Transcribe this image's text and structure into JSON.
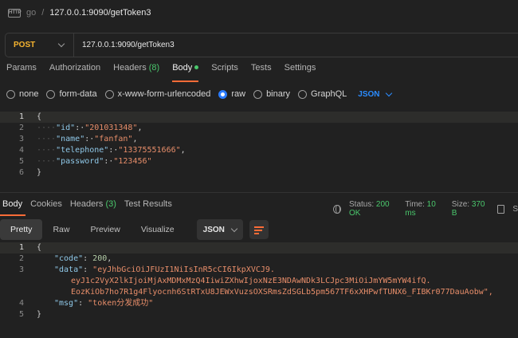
{
  "breadcrumb": {
    "badge": "HTTP",
    "workspace": "go",
    "separator": "/",
    "request_name": "127.0.0.1:9090/getToken3"
  },
  "url_bar": {
    "method": "POST",
    "url": "127.0.0.1:9090/getToken3",
    "method_color": "#f6b42f"
  },
  "request_tabs": [
    {
      "label": "Params"
    },
    {
      "label": "Authorization"
    },
    {
      "label": "Headers",
      "count": "(8)"
    },
    {
      "label": "Body",
      "active": true
    },
    {
      "label": "Scripts"
    },
    {
      "label": "Tests"
    },
    {
      "label": "Settings"
    }
  ],
  "body_types": {
    "options": [
      "none",
      "form-data",
      "x-www-form-urlencoded",
      "raw",
      "binary",
      "GraphQL"
    ],
    "selected": "raw",
    "format": "JSON"
  },
  "request_body": {
    "lines": [
      {
        "n": "1",
        "text": "{"
      },
      {
        "n": "2",
        "key": "\"id\"",
        "value": "\"201031348\""
      },
      {
        "n": "3",
        "key": "\"name\"",
        "value": "\"fanfan\""
      },
      {
        "n": "4",
        "key": "\"telephone\"",
        "value": "\"13375551666\""
      },
      {
        "n": "5",
        "key": "\"password\"",
        "value": "\"123456\""
      },
      {
        "n": "6",
        "text": "}"
      }
    ]
  },
  "response_tabs": [
    {
      "label": "Body",
      "active": true
    },
    {
      "label": "Cookies"
    },
    {
      "label": "Headers",
      "count": "(3)"
    },
    {
      "label": "Test Results"
    }
  ],
  "response_status": {
    "status_label": "Status:",
    "status_value": "200 OK",
    "time_label": "Time:",
    "time_value": "10 ms",
    "size_label": "Size:",
    "size_value": "370 B",
    "save_label": "S"
  },
  "response_toolbar": {
    "views": [
      "Pretty",
      "Raw",
      "Preview",
      "Visualize"
    ],
    "active_view": "Pretty",
    "format": "JSON"
  },
  "response_body": {
    "line1": {
      "n": "1",
      "text": "{"
    },
    "line2": {
      "n": "2",
      "key": "\"code\"",
      "value": "200"
    },
    "line3": {
      "n": "3",
      "key": "\"data\"",
      "value": "\"eyJhbGciOiJFUzI1NiIsInR5cCI6IkpXVCJ9."
    },
    "line3b": "eyJ1c2VyX2lkIjoiMjAxMDMxMzQ4IiwiZXhwIjoxNzE3NDAwNDk3LCJpc3MiOiJmYW5mYW4ifQ.",
    "line3c": "EozKiOb7ho7R1g4Flyocnh6StRTxU8JEWxVuzsOXSRmsZdSGLb5pm567TF6xXHPwfTUNX6_FIBKr077DauAobw\",",
    "line4": {
      "n": "4",
      "key": "\"msg\"",
      "value": "\"token分发成功\""
    },
    "line5": {
      "n": "5",
      "text": "}"
    }
  }
}
